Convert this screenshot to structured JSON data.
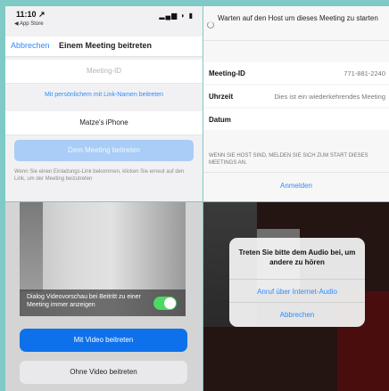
{
  "panel1": {
    "status_time": "11:10 ↗",
    "status_back": "◀ App Store",
    "status_indicators": "▂▄▆ ◗ ▮",
    "cancel_label": "Abbrechen",
    "title": "Einem Meeting beitreten",
    "meeting_id_placeholder": "Meeting-ID",
    "personal_link_label": "Mit persönlichem mit Link-Namen beitreten",
    "device_name": "Matze's iPhone",
    "join_button": "Dem Meeting beitreten",
    "hint_text": "Wenn Sie einen Einladungs-Link bekommen, klicken Sie erneut auf den Link, um der Meeting beizutreten"
  },
  "panel2": {
    "waiting_text": "Warten auf den Host um dieses Meeting zu starten",
    "rows": [
      {
        "label": "Meeting-ID",
        "value": "771-881-2240"
      },
      {
        "label": "Uhrzeit",
        "value": "Dies ist ein wiederkehrendes Meeting"
      },
      {
        "label": "Datum",
        "value": ""
      }
    ],
    "host_note": "WENN SIE HOST SIND, MELDEN SIE SICH ZUM START DIESES MEETINGS AN.",
    "login_label": "Anmelden"
  },
  "panel3": {
    "preview_toggle_label": "Dialog Videovorschau bei Beitritt zu einer Meeting immer anzeigen",
    "preview_toggle_on": true,
    "join_with_video": "Mit Video beitreten",
    "join_without_video": "Ohne Video beitreten"
  },
  "panel4": {
    "alert_title": "Treten Sie bitte dem Audio bei, um andere zu hören",
    "option_internet_audio": "Anruf über Internet-Audio",
    "option_cancel": "Abbrechen"
  },
  "colors": {
    "background": "#7fc9c6",
    "accent_blue": "#2d8cff",
    "primary_button": "#0e71eb",
    "disabled_button": "#a9cdf6",
    "toggle_on": "#4cd964"
  }
}
